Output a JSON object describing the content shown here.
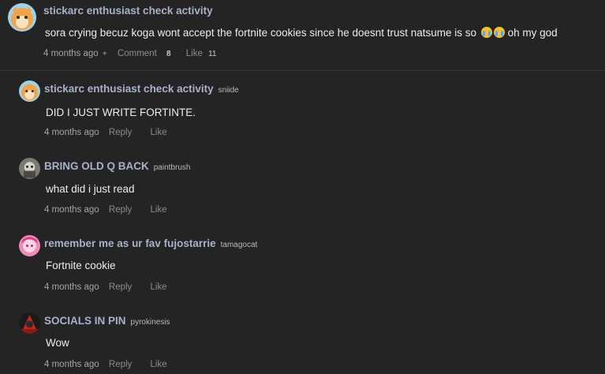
{
  "parent": {
    "username": "stickarc enthusiast check activity",
    "text": "sora crying becuz koga wont accept the fortnite cookies since he doesnt trust natsume is so",
    "text_suffix": "oh my god",
    "emoji": "loudly-crying-face",
    "time": "4 months ago",
    "plus": "+",
    "comment_label": "Comment",
    "comment_count": "8",
    "like_label": "Like",
    "like_count": "11"
  },
  "replies": [
    {
      "username": "stickarc enthusiast check activity",
      "tag": "sniide",
      "text": "DID I JUST WRITE FORTINTE.",
      "time": "4 months ago",
      "reply_label": "Reply",
      "like_label": "Like"
    },
    {
      "username": "BRING OLD Q BACK",
      "tag": "paintbrush",
      "text": "what did i just read",
      "time": "4 months ago",
      "reply_label": "Reply",
      "like_label": "Like"
    },
    {
      "username": "remember me as ur fav fujostarrie",
      "tag": "tamagocat",
      "text": "Fortnite cookie",
      "time": "4 months ago",
      "reply_label": "Reply",
      "like_label": "Like"
    },
    {
      "username": "SOCIALS IN PIN",
      "tag": "pyrokinesis",
      "text": "Wow",
      "time": "4 months ago",
      "reply_label": "Reply",
      "like_label": "Like"
    }
  ]
}
